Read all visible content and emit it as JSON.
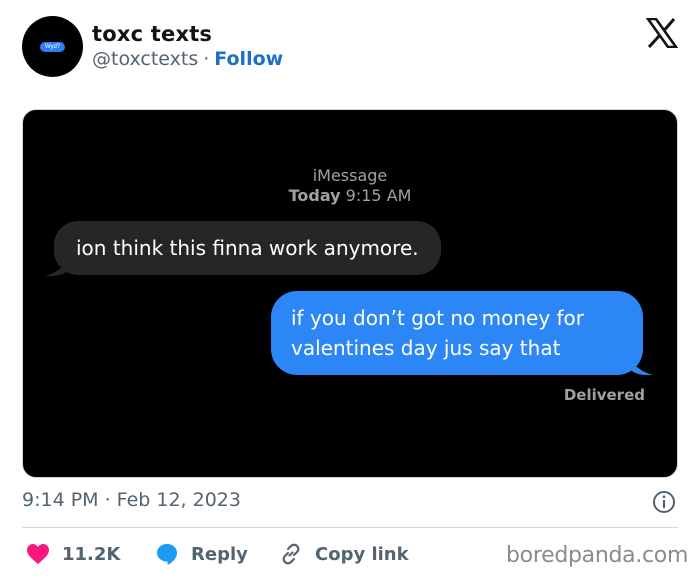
{
  "tweet": {
    "author_name": "toxc texts",
    "handle": "@toxctexts",
    "separator": "·",
    "follow_label": "Follow",
    "avatar_text": "Wyd?",
    "timestamp": "9:14 PM · Feb 12, 2023"
  },
  "screenshot": {
    "service": "iMessage",
    "day": "Today",
    "time": "9:15 AM",
    "incoming_message": "ion think this finna work anymore.",
    "outgoing_message_line1": "if you don’t got no money for",
    "outgoing_message_line2": "valentines day jus say that",
    "delivered_label": "Delivered"
  },
  "actions": {
    "like_count": "11.2K",
    "reply_label": "Reply",
    "copy_link_label": "Copy link"
  },
  "watermark": "boredpanda.com",
  "icons": [
    "x-logo-icon",
    "heart-icon",
    "reply-bubble-icon",
    "link-icon",
    "info-icon"
  ],
  "colors": {
    "follow_link": "#1d70c9",
    "like_heart": "#f91880",
    "reply_icon": "#1d9bf0",
    "imessage_blue": "#2d86f5",
    "incoming_bubble": "#262628"
  }
}
